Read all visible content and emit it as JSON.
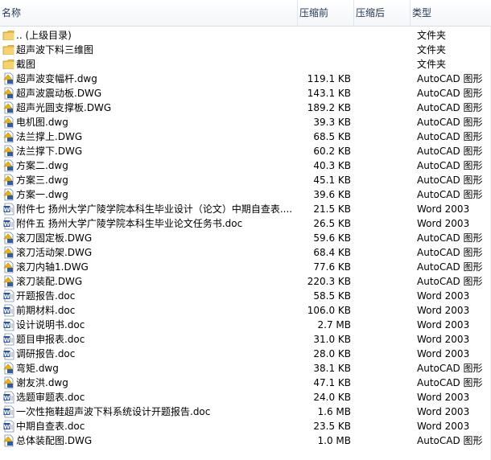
{
  "header": {
    "name": "名称",
    "packed": "压缩前",
    "unpacked": "压缩后",
    "type": "类型"
  },
  "rows": [
    {
      "icon": "folder-icon",
      "name": ".. (上级目录)",
      "size": "",
      "type": "文件夹"
    },
    {
      "icon": "folder-icon",
      "name": "超声波下料三维图",
      "size": "",
      "type": "文件夹"
    },
    {
      "icon": "folder-icon",
      "name": "截图",
      "size": "",
      "type": "文件夹"
    },
    {
      "icon": "autocad-icon",
      "name": "超声波变幅杆.dwg",
      "size": "119.1 KB",
      "type": "AutoCAD 图形"
    },
    {
      "icon": "autocad-icon",
      "name": "超声波震动板.DWG",
      "size": "143.1 KB",
      "type": "AutoCAD 图形"
    },
    {
      "icon": "autocad-icon",
      "name": "超声光圆支撑板.DWG",
      "size": "189.2 KB",
      "type": "AutoCAD 图形"
    },
    {
      "icon": "autocad-icon",
      "name": "电机图.dwg",
      "size": "39.3 KB",
      "type": "AutoCAD 图形"
    },
    {
      "icon": "autocad-icon",
      "name": "法兰撑上.DWG",
      "size": "68.5 KB",
      "type": "AutoCAD 图形"
    },
    {
      "icon": "autocad-icon",
      "name": "法兰撑下.DWG",
      "size": "60.2 KB",
      "type": "AutoCAD 图形"
    },
    {
      "icon": "autocad-icon",
      "name": "方案二.dwg",
      "size": "40.3 KB",
      "type": "AutoCAD 图形"
    },
    {
      "icon": "autocad-icon",
      "name": "方案三.dwg",
      "size": "45.1 KB",
      "type": "AutoCAD 图形"
    },
    {
      "icon": "autocad-icon",
      "name": "方案一.dwg",
      "size": "39.6 KB",
      "type": "AutoCAD 图形"
    },
    {
      "icon": "word-icon",
      "name": "附件七 扬州大学广陵学院本科生毕业设计（论文）中期自查表....",
      "size": "21.5 KB",
      "type": "Word 2003"
    },
    {
      "icon": "word-icon",
      "name": "附件五 扬州大学广陵学院本科生毕业论文任务书.doc",
      "size": "26.5 KB",
      "type": "Word 2003"
    },
    {
      "icon": "autocad-icon",
      "name": "滚刀固定板.DWG",
      "size": "59.6 KB",
      "type": "AutoCAD 图形"
    },
    {
      "icon": "autocad-icon",
      "name": "滚刀活动架.DWG",
      "size": "68.4 KB",
      "type": "AutoCAD 图形"
    },
    {
      "icon": "autocad-icon",
      "name": "滚刀内轴1.DWG",
      "size": "77.6 KB",
      "type": "AutoCAD 图形"
    },
    {
      "icon": "autocad-icon",
      "name": "滚刀装配.DWG",
      "size": "220.3 KB",
      "type": "AutoCAD 图形"
    },
    {
      "icon": "word-icon",
      "name": "开题报告.doc",
      "size": "58.5 KB",
      "type": "Word 2003"
    },
    {
      "icon": "word-icon",
      "name": "前期材料.doc",
      "size": "106.0 KB",
      "type": "Word 2003"
    },
    {
      "icon": "word-icon",
      "name": "设计说明书.doc",
      "size": "2.7 MB",
      "type": "Word 2003"
    },
    {
      "icon": "word-icon",
      "name": "题目申报表.doc",
      "size": "31.0 KB",
      "type": "Word 2003"
    },
    {
      "icon": "word-icon",
      "name": "调研报告.doc",
      "size": "28.0 KB",
      "type": "Word 2003"
    },
    {
      "icon": "autocad-icon",
      "name": "弯矩.dwg",
      "size": "38.1 KB",
      "type": "AutoCAD 图形"
    },
    {
      "icon": "autocad-icon",
      "name": "谢友洪.dwg",
      "size": "47.1 KB",
      "type": "AutoCAD 图形"
    },
    {
      "icon": "word-icon",
      "name": "选题审题表.doc",
      "size": "24.0 KB",
      "type": "Word 2003"
    },
    {
      "icon": "word-icon",
      "name": "一次性拖鞋超声波下料系统设计开题报告.doc",
      "size": "1.6 MB",
      "type": "Word 2003"
    },
    {
      "icon": "word-icon",
      "name": "中期自查表.doc",
      "size": "23.5 KB",
      "type": "Word 2003"
    },
    {
      "icon": "autocad-icon",
      "name": "总体装配图.DWG",
      "size": "1.0 MB",
      "type": "AutoCAD 图形"
    }
  ]
}
